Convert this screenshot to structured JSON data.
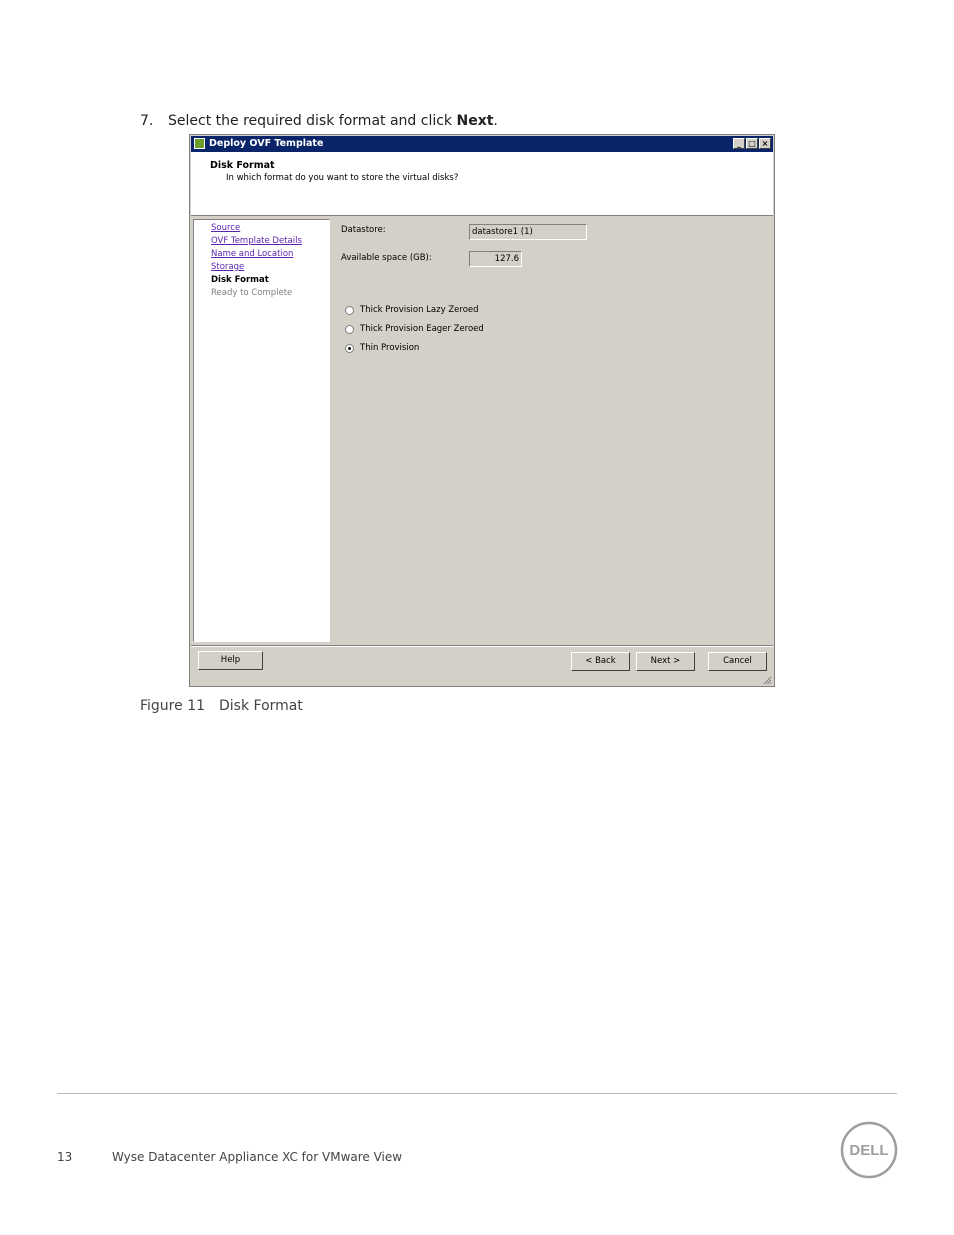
{
  "step": {
    "number": "7.",
    "text_before": "Select the required disk format and click ",
    "bold": "Next",
    "text_after": "."
  },
  "dialog": {
    "title": "Deploy OVF Template",
    "window_buttons": [
      "_",
      "□",
      "×"
    ],
    "header_title": "Disk Format",
    "header_subtitle": "In which format do you want to store the virtual disks?",
    "nav": [
      {
        "label": "Source",
        "state": "link"
      },
      {
        "label": "OVF Template Details",
        "state": "link"
      },
      {
        "label": "Name and Location",
        "state": "link"
      },
      {
        "label": "Storage",
        "state": "link"
      },
      {
        "label": "Disk Format",
        "state": "current"
      },
      {
        "label": "Ready to Complete",
        "state": "disabled"
      }
    ],
    "datastore_label": "Datastore:",
    "datastore_value": "datastore1 (1)",
    "space_label": "Available space (GB):",
    "space_value": "127.6",
    "options": [
      {
        "label": "Thick Provision Lazy Zeroed",
        "selected": false
      },
      {
        "label": "Thick Provision Eager Zeroed",
        "selected": false
      },
      {
        "label": "Thin Provision",
        "selected": true
      }
    ],
    "buttons": {
      "help": "Help",
      "back": "< Back",
      "next": "Next >",
      "cancel": "Cancel"
    }
  },
  "caption": {
    "figure": "Figure 11",
    "text": "Disk Format"
  },
  "footer": {
    "page_number": "13",
    "doc_title": "Wyse Datacenter Appliance XC for VMware View",
    "logo_text": "DELL"
  },
  "colors": {
    "title_bar": "#0a246a",
    "dialog_face": "#d4d0c8",
    "link": "#5a24b0"
  }
}
